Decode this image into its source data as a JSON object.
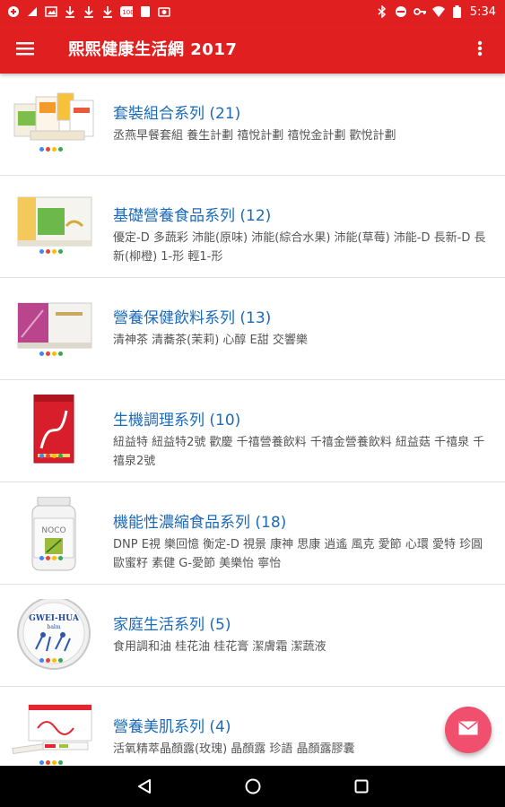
{
  "status_bar": {
    "time": "5:34",
    "battery_badge": "100"
  },
  "app_bar": {
    "title": "熙熙健康生活網 2017"
  },
  "categories": [
    {
      "title": "套裝組合系列 (21)",
      "desc": "丞燕早餐套組 養生計劃 禧悅計劃 禧悅金計劃 歡悅計劃"
    },
    {
      "title": "基礎營養食品系列 (12)",
      "desc": "優定-D 多蔬彩 沛能(原味) 沛能(綜合水果) 沛能(草莓) 沛能-D 長新-D 長新(柳橙) 1-形 輕1-形"
    },
    {
      "title": "營養保健飲料系列 (13)",
      "desc": "清神茶 清蕎茶(茉莉) 心醇 E甜 交響樂"
    },
    {
      "title": "生機調理系列 (10)",
      "desc": "紐益特 紐益特2號 歡慶 千禧營養飲料 千禧金營養飲料 紐益菇 千禧泉 千禧泉2號"
    },
    {
      "title": "機能性濃縮食品系列 (18)",
      "desc": "DNP E視 樂回憶 衡定-D 視景 康神 思康 逍遙 風克 愛節 心環 愛特 珍圓 歐蜜籽 素健 G-愛節 美樂怡 寧怡"
    },
    {
      "title": "家庭生活系列 (5)",
      "desc": "食用調和油 桂花油 桂花膏 潔膚霜 潔蔬液"
    },
    {
      "title": "營養美肌系列 (4)",
      "desc": "活氧精萃晶顏露(玫瑰) 晶顏露 珍語 晶顏露膠囊"
    }
  ],
  "product_labels": {
    "noco": "NOCO",
    "gwei_hua": "GWEI-HUA",
    "gwei_hua_sub": "balm"
  },
  "colors": {
    "primary": "#e02020",
    "link": "#1c6ab8",
    "fab": "#f0506e",
    "dots": [
      "#4285f4",
      "#ea4335",
      "#fbbc05",
      "#34a853"
    ]
  },
  "icons": {
    "menu": "hamburger-menu-icon",
    "more": "more-vert-icon",
    "fab": "mail-icon",
    "back": "back-triangle-icon",
    "home": "home-circle-icon",
    "recents": "recents-square-icon"
  }
}
